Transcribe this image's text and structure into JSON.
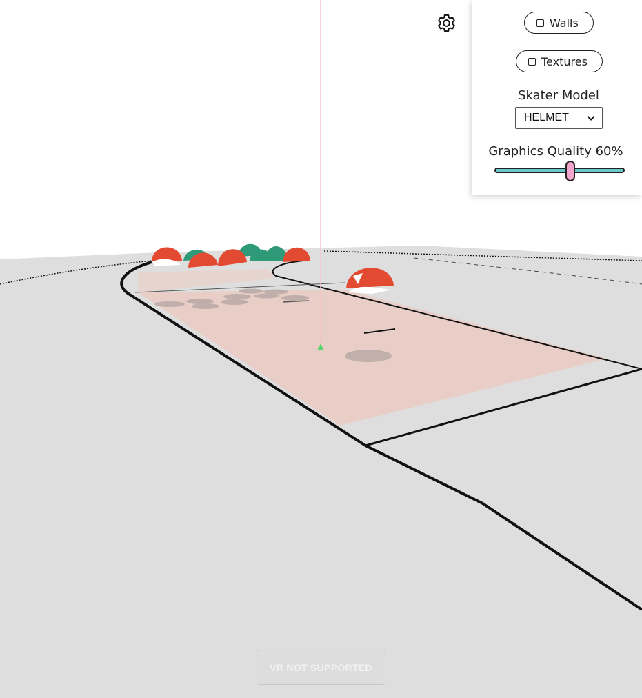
{
  "settings": {
    "gear_icon": "gear-icon",
    "walls_label": "Walls",
    "walls_checked": false,
    "textures_label": "Textures",
    "textures_checked": false,
    "skater_model_label": "Skater Model",
    "skater_model_selected": "HELMET",
    "graphics_quality_label": "Graphics Quality 60%",
    "graphics_quality_percent": 60
  },
  "vr_button_label": "VR NOT SUPPORTED",
  "colors": {
    "floor": "#dedede",
    "track_fill": "#e8cec6",
    "team_red": "#e24a32",
    "team_green": "#2f9a78",
    "slider_track": "#6bc8cb",
    "slider_thumb": "#f2a6cf"
  }
}
